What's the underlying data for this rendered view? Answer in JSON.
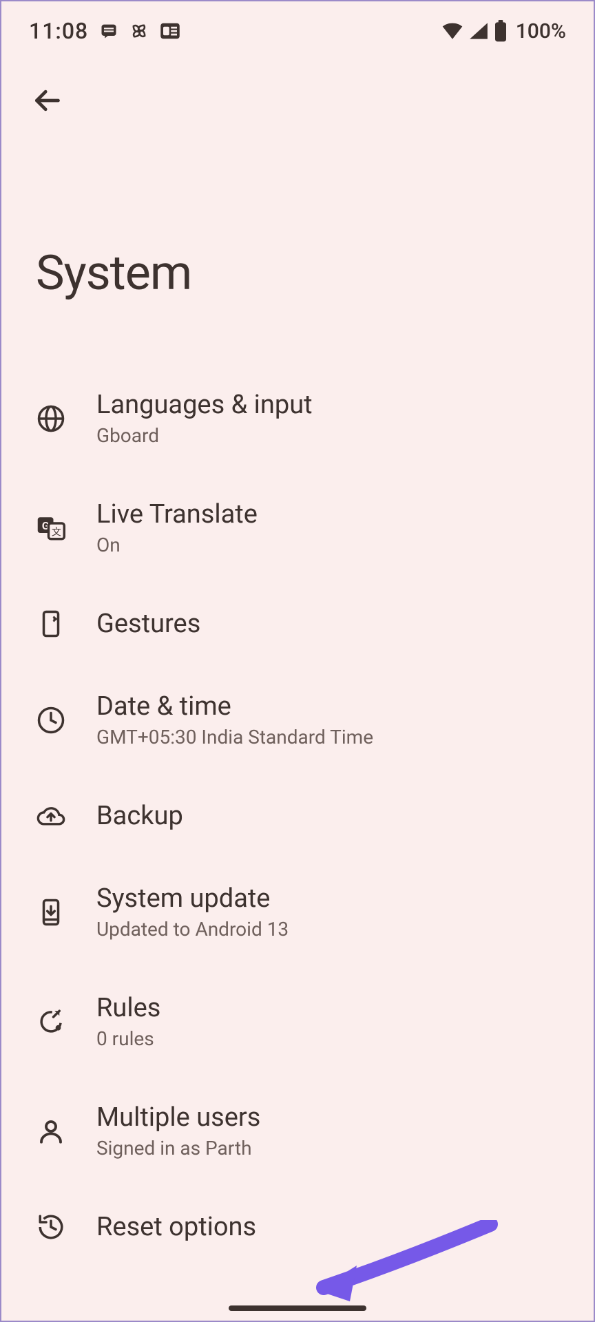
{
  "status": {
    "time": "11:08",
    "battery_percent": "100%"
  },
  "page": {
    "title": "System"
  },
  "settings": [
    {
      "title": "Languages & input",
      "subtitle": "Gboard"
    },
    {
      "title": "Live Translate",
      "subtitle": "On"
    },
    {
      "title": "Gestures",
      "subtitle": null
    },
    {
      "title": "Date & time",
      "subtitle": "GMT+05:30 India Standard Time"
    },
    {
      "title": "Backup",
      "subtitle": null
    },
    {
      "title": "System update",
      "subtitle": "Updated to Android 13"
    },
    {
      "title": "Rules",
      "subtitle": "0 rules"
    },
    {
      "title": "Multiple users",
      "subtitle": "Signed in as Parth"
    },
    {
      "title": "Reset options",
      "subtitle": null
    }
  ],
  "annotation": {
    "color": "#7659e8"
  }
}
